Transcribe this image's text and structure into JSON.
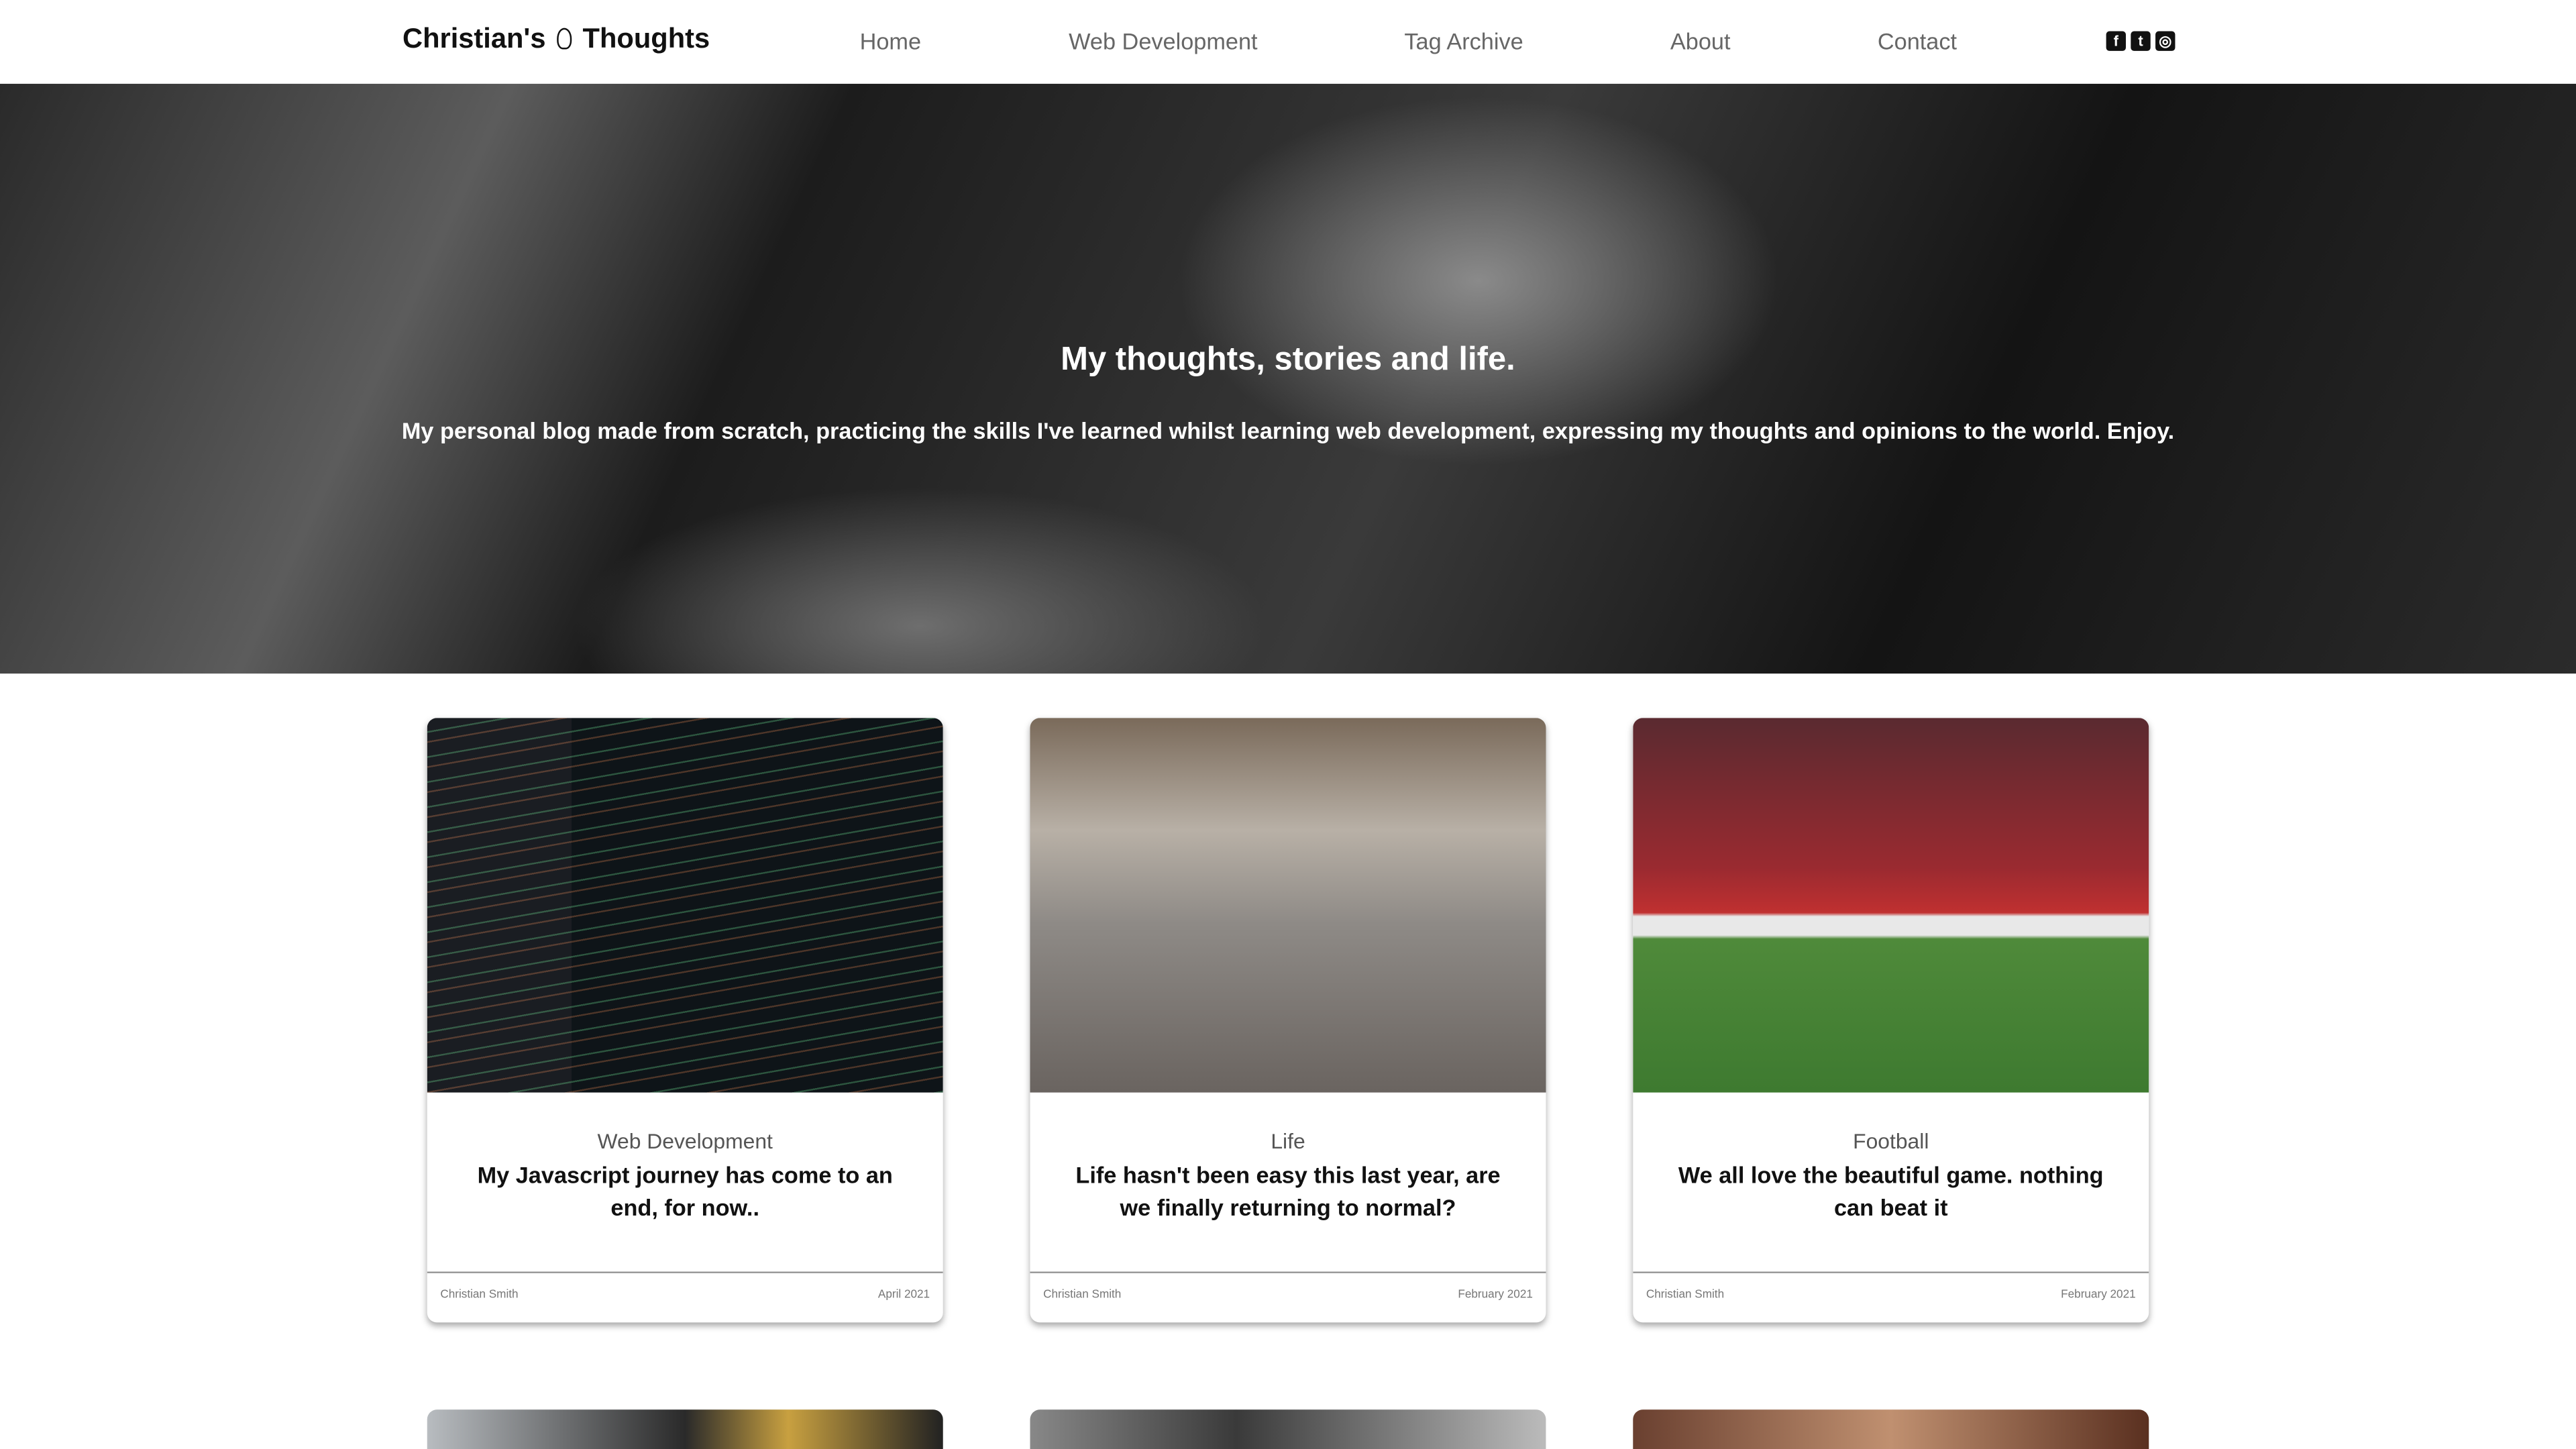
{
  "header": {
    "logo_part1": "Christian's",
    "logo_part2": "Thoughts",
    "nav": [
      "Home",
      "Web Development",
      "Tag Archive",
      "About",
      "Contact"
    ],
    "social": [
      {
        "icon": "facebook-icon",
        "glyph": "f"
      },
      {
        "icon": "twitter-icon",
        "glyph": "t"
      },
      {
        "icon": "instagram-icon",
        "glyph": "◎"
      }
    ]
  },
  "hero": {
    "title": "My thoughts, stories and life.",
    "subtitle": "My personal blog made from scratch, practicing the skills I've learned whilst learning web development, expressing my thoughts and opinions to the world. Enjoy."
  },
  "cards": [
    {
      "category": "Web Development",
      "title": "My Javascript journey has come to an end, for now..",
      "author": "Christian Smith",
      "date": "April 2021"
    },
    {
      "category": "Life",
      "title": "Life hasn't been easy this last year, are we finally returning to normal?",
      "author": "Christian Smith",
      "date": "February 2021"
    },
    {
      "category": "Football",
      "title": "We all love the beautiful game. nothing can beat it",
      "author": "Christian Smith",
      "date": "February 2021"
    }
  ]
}
